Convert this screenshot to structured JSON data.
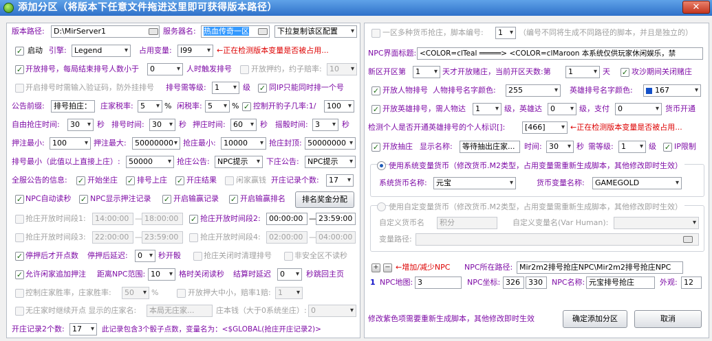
{
  "window": {
    "title": "添加分区（将版本下任意文件拖进这里即可获得版本路径）",
    "close": "✕"
  },
  "left": {
    "version_path_label": "版本路径:",
    "version_path_value": "D:\\MirServer1",
    "server_name_label": "服务器名:",
    "server_name_value": "热血传奇一区",
    "copy_config": "下拉复制该区配置",
    "start_label": "启动",
    "engine_label": "引擎:",
    "engine_value": "Legend",
    "var_label": "占用变量:",
    "var_value": "I99",
    "var_note": "←正在检测版本变量是否被占用...",
    "ranking_open": "开放排号，每局结束排号人数小于",
    "ranking_min": "0",
    "ranking_trigger": "人时触发排号",
    "open_bet": "开放押约，约子赔率:",
    "bet_odds": "10",
    "captcha": "开启排号时需输入验证码，防外挂排号",
    "level_label": "排号需等级:",
    "level_value": "1",
    "level_unit": "级",
    "same_ip": "同IP只能同时排一个号",
    "bulletin_label": "公告前缀:",
    "bulletin_value": "排号拍庄：",
    "tax_label": "庄家税率:",
    "tax_value": "5",
    "pct": "%",
    "idle_label": "闲税率:",
    "idle_value": "5",
    "control_odds": "控制开豹子几率:1/",
    "control_value": "100",
    "free_time_label": "自由抢庄时间:",
    "free_time_value": "30",
    "sec": "秒",
    "rank_time_label": "排号时间:",
    "rank_time_value": "30",
    "bet_time_label": "押庄时间:",
    "bet_time_value": "60",
    "shake_time_label": "摇骰时间:",
    "shake_time_value": "3",
    "bet_min_label": "押注最小:",
    "bet_min_value": "100",
    "bet_max_label": "押注最大:",
    "bet_max_value": "50000000",
    "grab_min_label": "抢庄最小:",
    "grab_min_value": "10000",
    "grab_cap_label": "抢庄封顶:",
    "grab_cap_value": "50000000",
    "rank_min_label": "排号最小（此值以上直接上庄）:",
    "rank_min_value": "50000",
    "grab_notice_label": "抢庄公告:",
    "grab_notice_value": "NPC提示",
    "down_notice_label": "下庄公告:",
    "down_notice_value": "NPC提示",
    "global_label": "全服公告的信息:",
    "start_bank": "开始坐庄",
    "rank_up": "排号上庄",
    "bank_result": "开庄结果",
    "idle_win": "闲家赢钱",
    "record_label": "开庄记录个数:",
    "record_value": "17",
    "npc_auto": "NPC自动读秒",
    "npc_show": "NPC显示押注记录",
    "win_log": "开启输赢记录",
    "win_rank": "开启输赢排名",
    "award_btn": "排名奖金分配",
    "period1_label": "抢庄开放时间段1:",
    "period1_from": "14:00:00",
    "period1_to": "18:00:00",
    "period2_label": "抢庄开放时间段2:",
    "period2_from": "00:00:00",
    "period2_to": "23:59:00",
    "period3_label": "抢庄开放时间段3:",
    "period3_from": "22:00:00",
    "period3_to": "23:59:00",
    "period4_label": "抢庄开放时间段4:",
    "period4_from": "02:00:00",
    "period4_to": "04:00:00",
    "dash": "—",
    "stop_dots": "停押后才开点数",
    "stop_delay_label": "停押后延迟:",
    "stop_delay_value": "0",
    "sec_open": "秒开骰",
    "clear_on_close": "抢庄关闭时清理排号",
    "not_win_read": "非安全区不读秒",
    "allow_extra": "允许闲家追加押注",
    "npc_range_label": "距离NPC范围:",
    "npc_range_value": "10",
    "close_read": "格时关闭读秒",
    "settle_delay_label": "结算时延迟",
    "settle_delay_value": "0",
    "settle_back": "秒跳回主页",
    "ctrl_bank": "控制庄家胜率，庄家胜率:",
    "ctrl_bank_value": "50",
    "big_small": "开放押大中小，赔率1赔:",
    "big_small_value": "1",
    "no_bank_label": "无庄家时继续开点 显示的庄家名:",
    "no_bank_value": "本局无庄家...",
    "bank_money_label": "庄本钱（大于0系统坐庄）:",
    "bank_money_value": "0",
    "rec2_label": "开庄记录2个数:",
    "rec2_value": "17",
    "rec2_note": "此记录包含3个骰子点数，变量名为：<$GLOBAL(抢庄开庄记录2)>"
  },
  "right": {
    "multi_currency": "一区多种货币抢庄，脚本编号:",
    "script_no": "1",
    "script_note": "（编号不同将生成不同路径的脚本，并且是独立的）",
    "npc_title_label": "NPC界面标题:",
    "npc_title_value": "<COLOR=clTeal ═════> <COLOR=clMaroon 本系统仅供玩家休闲娱乐，禁",
    "new_zone_label": "新区开区第",
    "new_zone_value": "1",
    "new_zone_mid": "天才开放赌庄，当前开区天数:第",
    "cur_day_value": "1",
    "day": "天",
    "siege_close": "攻沙期间关闭赌庄",
    "open_person": "开放人物排号",
    "person_color_label": "人物排号名字颜色:",
    "person_color_value": "255",
    "hero_color_label": "英雄排号名字颜色:",
    "hero_color_value": "167",
    "hero_color_hex": "#1450c8",
    "open_hero": "开放英雄排号，需人物达",
    "hero_p_level": "1",
    "hero_lv_mid": "级，英雄达",
    "hero_h_level": "0",
    "hero_pay": "级，支付",
    "hero_pay_value": "0",
    "currency_open": "货币开通",
    "detect_label": "检测个人是否开通英雄排号的个人标识[]:",
    "detect_value": "[466]",
    "detect_note": "←正在检测版本变量是否被占用...",
    "open_grab": "开放抽庄",
    "display_name_label": "显示名称:",
    "display_name_value": "等待抽出庄家...",
    "time_label": "时间:",
    "time_value": "30",
    "need_level_label": "需等级:",
    "need_level_value": "1",
    "ip_limit": "IP限制",
    "sys_currency_radio": "使用系统变量货币（修改货币.M2类型，占用变量需重新生成脚本，其他修改即时生效）",
    "sys_currency_name_label": "系统货币名称:",
    "sys_currency_name_value": "元宝",
    "currency_var_label": "货币变量名称:",
    "currency_var_value": "GAMEGOLD",
    "custom_currency_radio": "使用自定变量货币（修改货币.M2类型，占用变量需重新生成脚本，其他修改即时生效）",
    "custom_name_label": "自定义货币名",
    "custom_name_value": "积分",
    "custom_var_label": "自定义变量名(Var Human):",
    "custom_var_value": "",
    "var_path_label": "变量路径:",
    "add_npc": "←增加/减少NPC",
    "npc_path_label": "NPC所在路径:",
    "npc_path_value": "Mir2m2排号抢庄NPC\\Mir2m2排号抢庄NPC",
    "npc_index": "1",
    "npc_map_label": "NPC地图:",
    "npc_map_value": "3",
    "npc_coord_label": "NPC坐标:",
    "npc_x": "326",
    "npc_y": "330",
    "npc_name_label": "NPC名称:",
    "npc_name_value": "元宝排号抢庄",
    "look_label": "外观:",
    "look_value": "12",
    "footer_note": "修改紫色项需要重新生成脚本，其他修改即时生效",
    "confirm_btn": "确定添加分区",
    "cancel_btn": "取消"
  }
}
